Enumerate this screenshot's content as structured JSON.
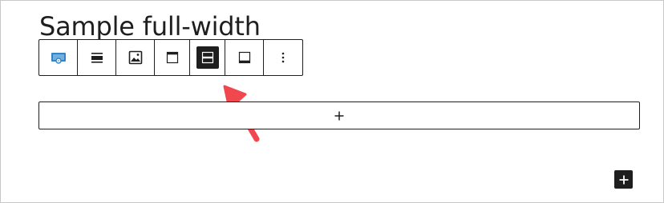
{
  "editor": {
    "heading": "Sample full-width"
  },
  "toolbar": {
    "buttons": [
      {
        "name": "block-type-icon",
        "label": "Cover block"
      },
      {
        "name": "align-icon",
        "label": "Align"
      },
      {
        "name": "replace-image-icon",
        "label": "Replace media"
      },
      {
        "name": "content-position-top-icon",
        "label": "Content position top"
      },
      {
        "name": "content-position-center-icon",
        "label": "Content position center",
        "active": true
      },
      {
        "name": "content-position-bottom-icon",
        "label": "Content position bottom"
      },
      {
        "name": "more-options-icon",
        "label": "More options"
      }
    ]
  },
  "add_block": {
    "symbol": "+"
  },
  "inserter": {
    "symbol": "+"
  },
  "colors": {
    "accent": "#3582c4",
    "dark": "#1e1e1e",
    "arrow": "#f0484e"
  }
}
